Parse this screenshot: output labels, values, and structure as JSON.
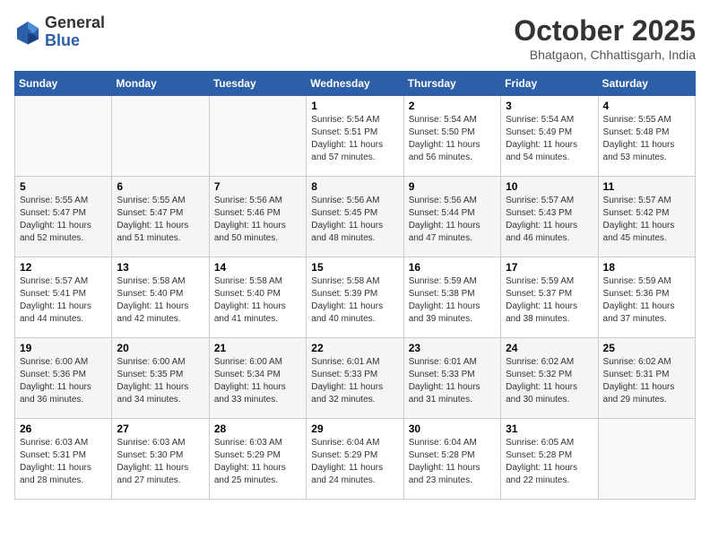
{
  "header": {
    "logo_line1": "General",
    "logo_line2": "Blue",
    "month": "October 2025",
    "location": "Bhatgaon, Chhattisgarh, India"
  },
  "days_of_week": [
    "Sunday",
    "Monday",
    "Tuesday",
    "Wednesday",
    "Thursday",
    "Friday",
    "Saturday"
  ],
  "weeks": [
    [
      {
        "num": "",
        "info": ""
      },
      {
        "num": "",
        "info": ""
      },
      {
        "num": "",
        "info": ""
      },
      {
        "num": "1",
        "info": "Sunrise: 5:54 AM\nSunset: 5:51 PM\nDaylight: 11 hours and 57 minutes."
      },
      {
        "num": "2",
        "info": "Sunrise: 5:54 AM\nSunset: 5:50 PM\nDaylight: 11 hours and 56 minutes."
      },
      {
        "num": "3",
        "info": "Sunrise: 5:54 AM\nSunset: 5:49 PM\nDaylight: 11 hours and 54 minutes."
      },
      {
        "num": "4",
        "info": "Sunrise: 5:55 AM\nSunset: 5:48 PM\nDaylight: 11 hours and 53 minutes."
      }
    ],
    [
      {
        "num": "5",
        "info": "Sunrise: 5:55 AM\nSunset: 5:47 PM\nDaylight: 11 hours and 52 minutes."
      },
      {
        "num": "6",
        "info": "Sunrise: 5:55 AM\nSunset: 5:47 PM\nDaylight: 11 hours and 51 minutes."
      },
      {
        "num": "7",
        "info": "Sunrise: 5:56 AM\nSunset: 5:46 PM\nDaylight: 11 hours and 50 minutes."
      },
      {
        "num": "8",
        "info": "Sunrise: 5:56 AM\nSunset: 5:45 PM\nDaylight: 11 hours and 48 minutes."
      },
      {
        "num": "9",
        "info": "Sunrise: 5:56 AM\nSunset: 5:44 PM\nDaylight: 11 hours and 47 minutes."
      },
      {
        "num": "10",
        "info": "Sunrise: 5:57 AM\nSunset: 5:43 PM\nDaylight: 11 hours and 46 minutes."
      },
      {
        "num": "11",
        "info": "Sunrise: 5:57 AM\nSunset: 5:42 PM\nDaylight: 11 hours and 45 minutes."
      }
    ],
    [
      {
        "num": "12",
        "info": "Sunrise: 5:57 AM\nSunset: 5:41 PM\nDaylight: 11 hours and 44 minutes."
      },
      {
        "num": "13",
        "info": "Sunrise: 5:58 AM\nSunset: 5:40 PM\nDaylight: 11 hours and 42 minutes."
      },
      {
        "num": "14",
        "info": "Sunrise: 5:58 AM\nSunset: 5:40 PM\nDaylight: 11 hours and 41 minutes."
      },
      {
        "num": "15",
        "info": "Sunrise: 5:58 AM\nSunset: 5:39 PM\nDaylight: 11 hours and 40 minutes."
      },
      {
        "num": "16",
        "info": "Sunrise: 5:59 AM\nSunset: 5:38 PM\nDaylight: 11 hours and 39 minutes."
      },
      {
        "num": "17",
        "info": "Sunrise: 5:59 AM\nSunset: 5:37 PM\nDaylight: 11 hours and 38 minutes."
      },
      {
        "num": "18",
        "info": "Sunrise: 5:59 AM\nSunset: 5:36 PM\nDaylight: 11 hours and 37 minutes."
      }
    ],
    [
      {
        "num": "19",
        "info": "Sunrise: 6:00 AM\nSunset: 5:36 PM\nDaylight: 11 hours and 36 minutes."
      },
      {
        "num": "20",
        "info": "Sunrise: 6:00 AM\nSunset: 5:35 PM\nDaylight: 11 hours and 34 minutes."
      },
      {
        "num": "21",
        "info": "Sunrise: 6:00 AM\nSunset: 5:34 PM\nDaylight: 11 hours and 33 minutes."
      },
      {
        "num": "22",
        "info": "Sunrise: 6:01 AM\nSunset: 5:33 PM\nDaylight: 11 hours and 32 minutes."
      },
      {
        "num": "23",
        "info": "Sunrise: 6:01 AM\nSunset: 5:33 PM\nDaylight: 11 hours and 31 minutes."
      },
      {
        "num": "24",
        "info": "Sunrise: 6:02 AM\nSunset: 5:32 PM\nDaylight: 11 hours and 30 minutes."
      },
      {
        "num": "25",
        "info": "Sunrise: 6:02 AM\nSunset: 5:31 PM\nDaylight: 11 hours and 29 minutes."
      }
    ],
    [
      {
        "num": "26",
        "info": "Sunrise: 6:03 AM\nSunset: 5:31 PM\nDaylight: 11 hours and 28 minutes."
      },
      {
        "num": "27",
        "info": "Sunrise: 6:03 AM\nSunset: 5:30 PM\nDaylight: 11 hours and 27 minutes."
      },
      {
        "num": "28",
        "info": "Sunrise: 6:03 AM\nSunset: 5:29 PM\nDaylight: 11 hours and 25 minutes."
      },
      {
        "num": "29",
        "info": "Sunrise: 6:04 AM\nSunset: 5:29 PM\nDaylight: 11 hours and 24 minutes."
      },
      {
        "num": "30",
        "info": "Sunrise: 6:04 AM\nSunset: 5:28 PM\nDaylight: 11 hours and 23 minutes."
      },
      {
        "num": "31",
        "info": "Sunrise: 6:05 AM\nSunset: 5:28 PM\nDaylight: 11 hours and 22 minutes."
      },
      {
        "num": "",
        "info": ""
      }
    ]
  ]
}
